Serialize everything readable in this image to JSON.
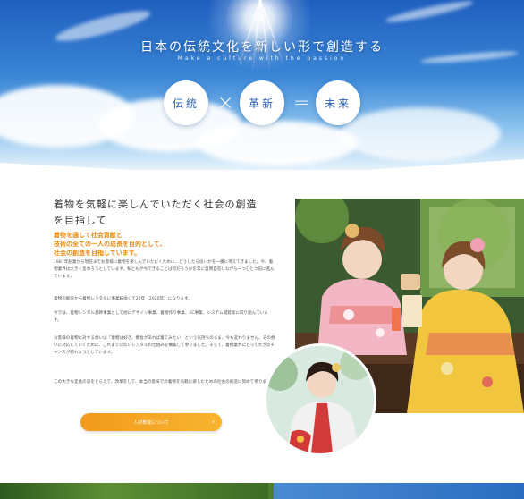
{
  "hero": {
    "title": "日本の伝統文化を新しい形で創造する",
    "subtitle": "Make a culture with the passion",
    "circles": [
      "伝統",
      "革新",
      "未来"
    ],
    "operators": [
      "×",
      "="
    ]
  },
  "main": {
    "heading_line1": "着物を気軽に楽しんでいただく社会の創造",
    "heading_line2": "を目指して",
    "catch_line1": "着物を通して社会貢献と",
    "catch_line2": "技術の全ての一人の成長を目的として、",
    "catch_line3": "社会の創造を目指しています。",
    "paragraphs": [
      "1987年創業から現在までお客様に着物を楽しんでいただくために、どうしたら良いかを一番に考えてきました。今、着物業界は大きく変わろうとしています。私どもが今できることは何だろうかを常に自問自答しながら一つひとつ前に進んでいます。",
      "着物の販売から着物レンタルに事業転換して20年（2020年）になります。",
      "今では、着物レンタル基幹事業として他にデザイン事業、着物作り事業、EC事業、システム開発等に取り組んでいます。",
      "お客様の着物に対する想いは「着物は好き、機会があれば着てみたい」という気持ちのまま、今も変わりません。その想いに対応していくために、これまでにないレンタルの仕組みを構築して参りました。そして、着物業界にとって大きなチャンスが訪れようとしています。",
      "この大きな変化の波をとらえて、改革をして、本当の意味での着物を気軽に楽しむための社会の創造に努めて参ります。"
    ],
    "button_label": "人材育成について",
    "button_arrow": "›"
  },
  "colors": {
    "accent_orange": "#f29a1e",
    "sky_blue": "#2c6cc0",
    "heading_text": "#333333"
  }
}
